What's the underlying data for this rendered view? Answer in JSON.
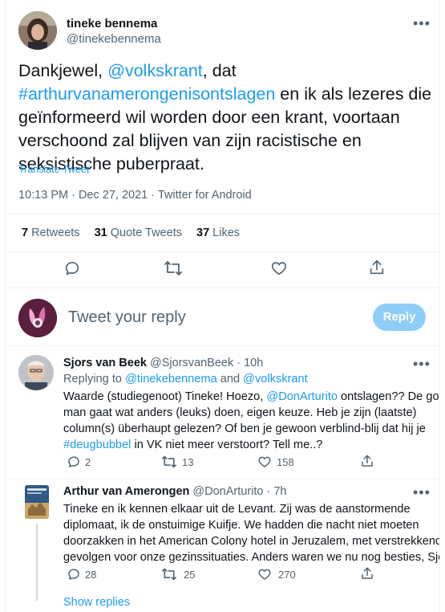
{
  "main_tweet": {
    "display_name": "tineke bennema",
    "handle": "@tinekebennema",
    "text_parts": {
      "p1": "Dankjewel, ",
      "mention": "@volkskrant",
      "p2": ", dat",
      "hashtag": "#arthurvanamerongenisontslagen",
      "p3": " en ik als lezeres die",
      "line3": "geïnformeerd wil worden door een krant, voortaan",
      "line4": "verschoond zal blijven van zijn racistische en",
      "line5": "seksistische puberpraat."
    },
    "translate_label": "Translate Tweet",
    "timestamp": "10:13 PM · Dec 27, 2021 · Twitter for Android",
    "stats": {
      "retweets_count": "7",
      "retweets_label": "Retweets",
      "quotes_count": "31",
      "quotes_label": "Quote Tweets",
      "likes_count": "37",
      "likes_label": "Likes"
    }
  },
  "compose": {
    "placeholder": "Tweet your reply",
    "reply_button": "Reply"
  },
  "replies": [
    {
      "display_name": "Sjors van Beek",
      "handle": "@SjorsvanBeek",
      "time": "· 10h",
      "replying_prefix": "Replying to ",
      "replying_user1": "@tinekebennema",
      "replying_and": " and ",
      "replying_user2": "@volkskrant",
      "l1a": "Waarde (studiegenoot) Tineke! Hoezo, ",
      "l1m": "@DonArturito",
      "l1b": " ontslagen?? De goede",
      "l2": "man gaat wat anders (leuks) doen, eigen keuze. Heb je zijn (laatste)",
      "l3": "column(s) überhaupt gelezen? Of ben je gewoon verblind-blij dat hij je",
      "l4h": "#deugbubbel",
      "l4b": " in VK niet meer verstoort? Tell me..?",
      "reply_count": "2",
      "retweet_count": "13",
      "like_count": "158"
    },
    {
      "display_name": "Arthur van Amerongen",
      "handle": "@DonArturito",
      "time": "· 7h",
      "l1": "Tineke en ik kennen elkaar uit de Levant. Zij was de aanstormende",
      "l2": "diplomaat, ik de onstuimige Kuifje. We hadden die nacht niet moeten",
      "l3": "doorzakken in het American Colony hotel in Jeruzalem, met verstrekkend",
      "l4": "gevolgen voor onze gezinssituaties. Anders waren we nu nog besties, Sjors.",
      "reply_count": "28",
      "retweet_count": "25",
      "like_count": "270"
    }
  ],
  "show_replies": "Show replies",
  "more_glyph": "•••",
  "colors": {
    "accent": "#1d9bf0",
    "reply_button_disabled": "#8ecdf8",
    "text_primary": "#0f1419",
    "text_secondary": "#536471",
    "divider": "#eff3f4"
  }
}
